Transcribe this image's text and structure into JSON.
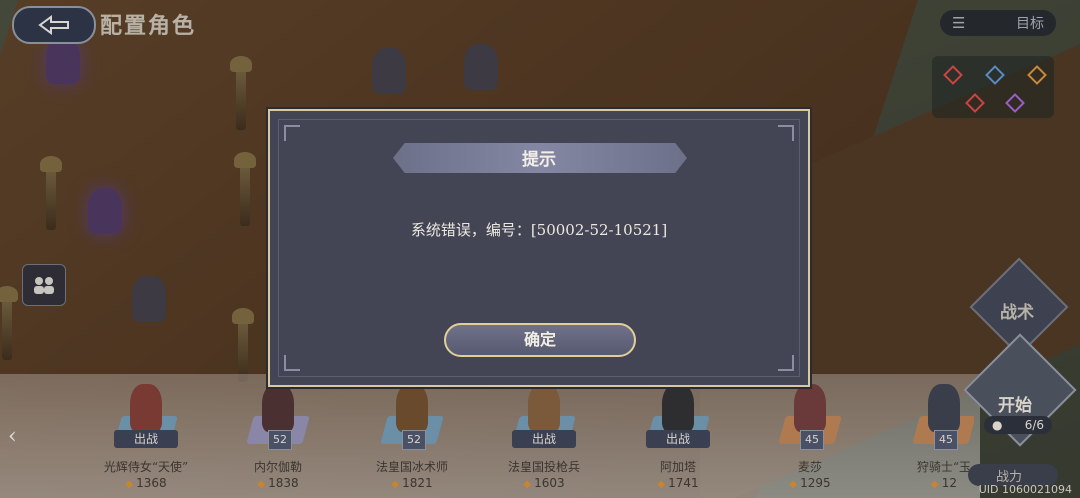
{
  "top_bar": {
    "title": "配置角色",
    "target_label": "目标"
  },
  "dialog": {
    "title": "提示",
    "message": "系统错误，编号：[50002-52-10521]",
    "confirm_label": "确定"
  },
  "side_buttons": {
    "tactic_label": "战术",
    "start_label": "开始",
    "deploy_count": "6/6",
    "power_label": "战力"
  },
  "roster": [
    {
      "name": "光辉侍女“天使”",
      "power": "1368",
      "badge": "出战"
    },
    {
      "name": "内尔伽勒",
      "power": "1838",
      "badge": "52"
    },
    {
      "name": "法皇国冰术师",
      "power": "1821",
      "badge": "52"
    },
    {
      "name": "法皇国投枪兵",
      "power": "1603",
      "badge": "出战"
    },
    {
      "name": "阿加塔",
      "power": "1741",
      "badge": "出战"
    },
    {
      "name": "麦莎",
      "power": "1295",
      "badge": "45"
    },
    {
      "name": "狩骑士“玉",
      "power": "12",
      "badge": "45"
    }
  ],
  "footer": {
    "uid": "UID 1060021094"
  }
}
